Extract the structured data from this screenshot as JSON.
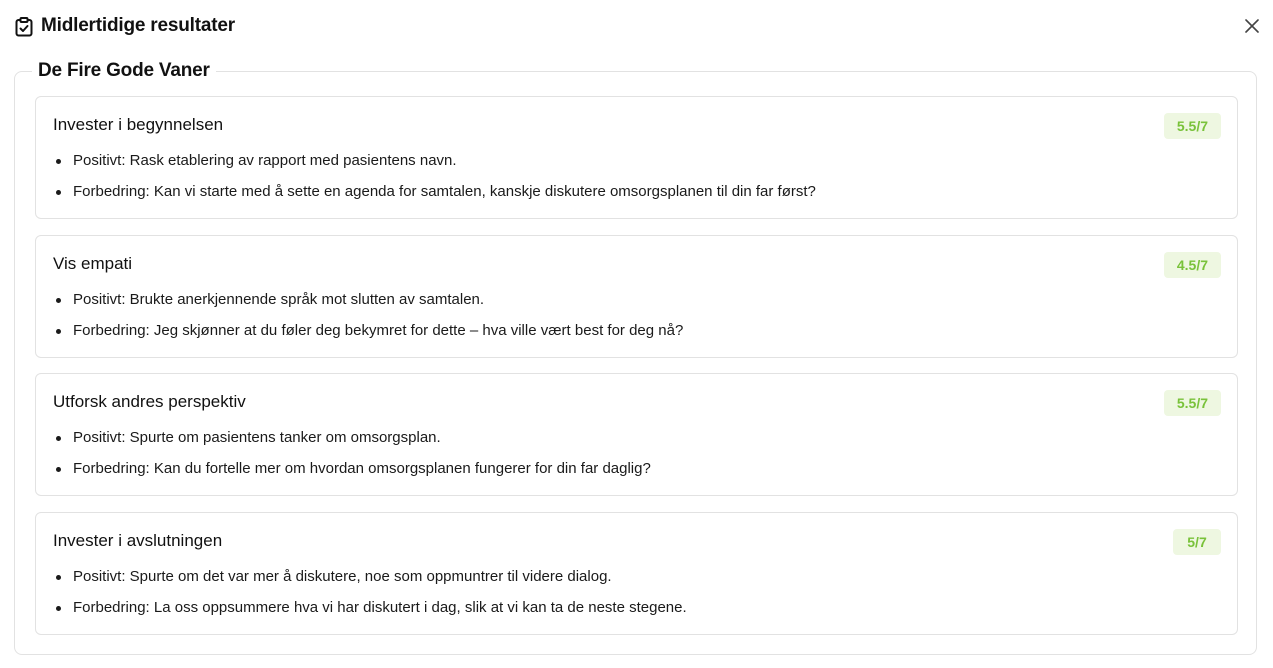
{
  "dialog": {
    "title": "Midlertidige resultater",
    "icon": "clipboard-check-icon",
    "close_icon": "close-icon"
  },
  "section": {
    "title": "De Fire Gode Vaner"
  },
  "cards": [
    {
      "title": "Invester i begynnelsen",
      "score": "5.5/7",
      "positive": "Positivt: Rask etablering av rapport med pasientens navn.",
      "improvement": "Forbedring: Kan vi starte med å sette en agenda for samtalen, kanskje diskutere omsorgsplanen til din far først?"
    },
    {
      "title": "Vis empati",
      "score": "4.5/7",
      "positive": "Positivt: Brukte anerkjennende språk mot slutten av samtalen.",
      "improvement": "Forbedring: Jeg skjønner at du føler deg bekymret for dette – hva ville vært best for deg nå?"
    },
    {
      "title": "Utforsk andres perspektiv",
      "score": "5.5/7",
      "positive": "Positivt: Spurte om pasientens tanker om omsorgsplan.",
      "improvement": "Forbedring: Kan du fortelle mer om hvordan omsorgsplanen fungerer for din far daglig?"
    },
    {
      "title": "Invester i avslutningen",
      "score": "5/7",
      "positive": "Positivt: Spurte om det var mer å diskutere, noe som oppmuntrer til videre dialog.",
      "improvement": "Forbedring: La oss oppsummere hva vi har diskutert i dag, slik at vi kan ta de neste stegene."
    }
  ],
  "colors": {
    "score_text": "#79c23a",
    "score_bg": "#eef7e1",
    "border": "#e2e2e2"
  }
}
